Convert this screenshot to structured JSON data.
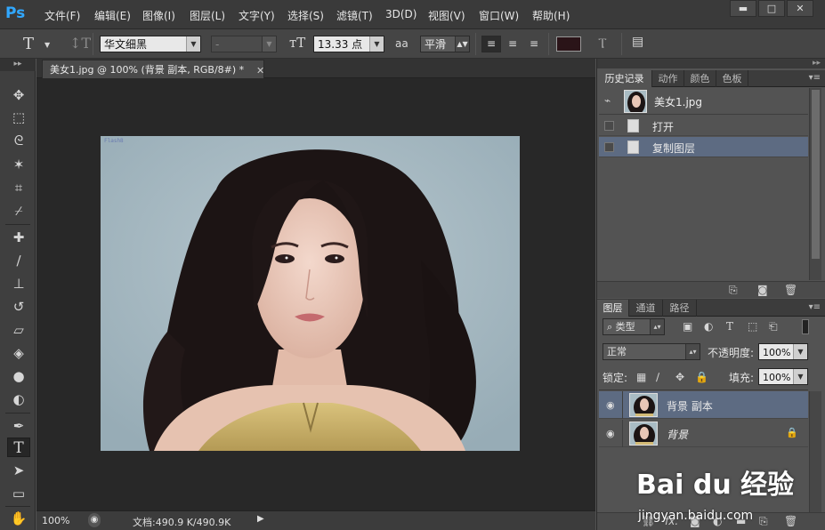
{
  "app": {
    "logo": "Ps"
  },
  "menu": {
    "items": [
      "文件(F)",
      "编辑(E)",
      "图像(I)",
      "图层(L)",
      "文字(Y)",
      "选择(S)",
      "滤镜(T)",
      "3D(D)",
      "视图(V)",
      "窗口(W)",
      "帮助(H)"
    ]
  },
  "window_controls": {
    "minimize": "▬",
    "maximize": "□",
    "close": "✕"
  },
  "options": {
    "font_family": "华文细黑",
    "font_style": "-",
    "font_size": "13.33 点",
    "antialias_label": "aa",
    "antialias": "平滑",
    "text_color": "#2a1418"
  },
  "document": {
    "tab_title": "美女1.jpg @ 100% (背景 副本, RGB/8#) *",
    "tab_close": "✕",
    "watermark": "Flash8",
    "zoom": "100%",
    "doc_size": "文档:490.9 K/490.9K"
  },
  "history_panel": {
    "tabs": [
      "历史记录",
      "动作",
      "颜色",
      "色板"
    ],
    "snapshot_name": "美女1.jpg",
    "items": [
      {
        "label": "打开",
        "selected": false
      },
      {
        "label": "复制图层",
        "selected": true
      }
    ]
  },
  "layers_panel": {
    "tabs": [
      "图层",
      "通道",
      "路径"
    ],
    "filter_kind": "类型",
    "blend_mode": "正常",
    "opacity_label": "不透明度:",
    "opacity": "100%",
    "lock_label": "锁定:",
    "fill_label": "填充:",
    "fill": "100%",
    "layers": [
      {
        "name": "背景 副本",
        "selected": true,
        "locked": false
      },
      {
        "name": "背景",
        "selected": false,
        "locked": true
      }
    ]
  },
  "overlay_watermark": {
    "brand": "Bai du 经验",
    "url": "jingyan.baidu.com"
  },
  "colors": {
    "selection": "#5d6b82",
    "canvas_bg": "#a9bcc4",
    "ps_blue": "#31a8ff"
  }
}
